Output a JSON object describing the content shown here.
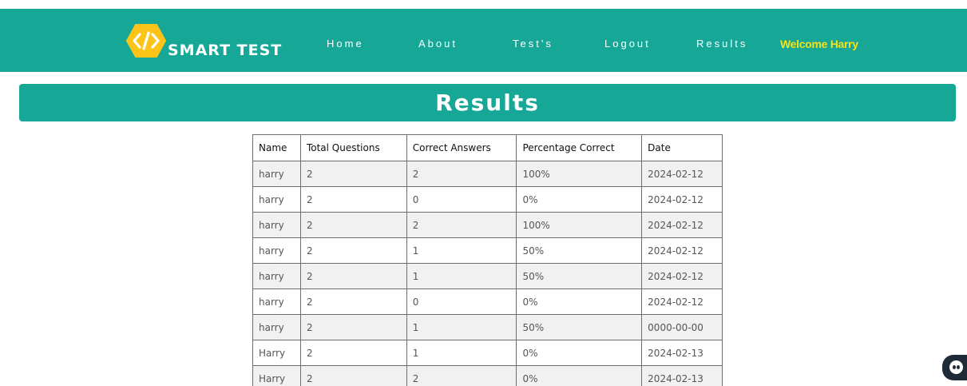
{
  "header": {
    "logo_text": "SMART TEST",
    "nav": [
      {
        "label": "Home"
      },
      {
        "label": "About"
      },
      {
        "label": "Test's"
      },
      {
        "label": "Logout"
      },
      {
        "label": "Results"
      }
    ],
    "welcome": "Welcome Harry"
  },
  "page_title": "Results",
  "table": {
    "headers": [
      "Name",
      "Total Questions",
      "Correct Answers",
      "Percentage Correct",
      "Date"
    ],
    "rows": [
      [
        "harry",
        "2",
        "2",
        "100%",
        "2024-02-12"
      ],
      [
        "harry",
        "2",
        "0",
        "0%",
        "2024-02-12"
      ],
      [
        "harry",
        "2",
        "2",
        "100%",
        "2024-02-12"
      ],
      [
        "harry",
        "2",
        "1",
        "50%",
        "2024-02-12"
      ],
      [
        "harry",
        "2",
        "1",
        "50%",
        "2024-02-12"
      ],
      [
        "harry",
        "2",
        "0",
        "0%",
        "2024-02-12"
      ],
      [
        "harry",
        "2",
        "1",
        "50%",
        "0000-00-00"
      ],
      [
        "Harry",
        "2",
        "1",
        "0%",
        "2024-02-13"
      ],
      [
        "Harry",
        "2",
        "2",
        "0%",
        "2024-02-13"
      ]
    ]
  },
  "colors": {
    "brand": "#16a796",
    "logo_hex": "#fcc419",
    "welcome": "#f5e21b",
    "chat_widget": "#1f2a38"
  },
  "icons": {
    "logo": "code-brackets-hexagon-icon",
    "chat": "chat-bot-icon"
  }
}
